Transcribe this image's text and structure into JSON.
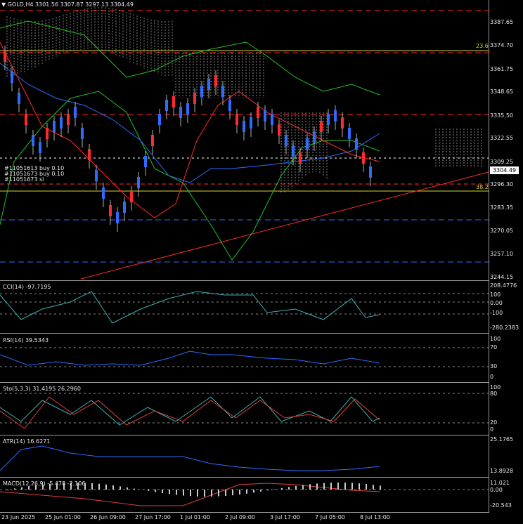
{
  "header": {
    "symbol_line": "GOLD,H4  3301.56 3307.87 3297.13 3304.49",
    "arrow_icon": "triangle-down"
  },
  "main": {
    "y_ticks": [
      "3387.65",
      "3374.70",
      "3361.75",
      "3348.65",
      "3335.50",
      "3322.55",
      "3309.25",
      "3296.30",
      "3283.35",
      "3270.05",
      "3257.10",
      "3244.15"
    ],
    "current_price": "3304.49",
    "fib_236": "23.6",
    "fib_382": "38.2",
    "order_labels": [
      "#11051613 buy 0.10",
      "#11051673 buy 0.10",
      "#11051673 sl"
    ]
  },
  "cci": {
    "title": "CCI(14) -97.7195",
    "ticks": [
      "208.4776",
      "100",
      "0.00",
      "-100",
      "-280.2383"
    ]
  },
  "rsi": {
    "title": "RSI(14) 39.5343",
    "ticks": [
      "100",
      "70",
      "30",
      "0"
    ]
  },
  "sto": {
    "title": "Sto(5,3,3) 31.4195 26.2960",
    "ticks": [
      "100",
      "80",
      "20",
      "0"
    ]
  },
  "atr": {
    "title": "ATR(14) 16.6271",
    "ticks": [
      "25.1765",
      "13.8928"
    ]
  },
  "macd": {
    "title": "MACD(12,26,9) -5.478 -2.106",
    "ticks": [
      "11.021",
      "0.00",
      "-20.543"
    ]
  },
  "time_axis": [
    "23 Jun 2025",
    "25 Jun 01:00",
    "26 Jun 09:00",
    "27 Jun 17:00",
    "1 Jul 01:00",
    "2 Jul 09:00",
    "3 Jul 17:00",
    "7 Jul 05:00",
    "8 Jul 13:00"
  ],
  "colors": {
    "bull": "#2d6cff",
    "bear": "#ff2a2a",
    "bg": "#000000",
    "grid": "#9a9a9a",
    "ma_green": "#22c322",
    "ma_blue": "#2d6cff",
    "ma_red": "#ff2a2a",
    "osc_line": "#42b0b0",
    "signal": "#e04040",
    "level_yellow": "#d8d830"
  }
}
